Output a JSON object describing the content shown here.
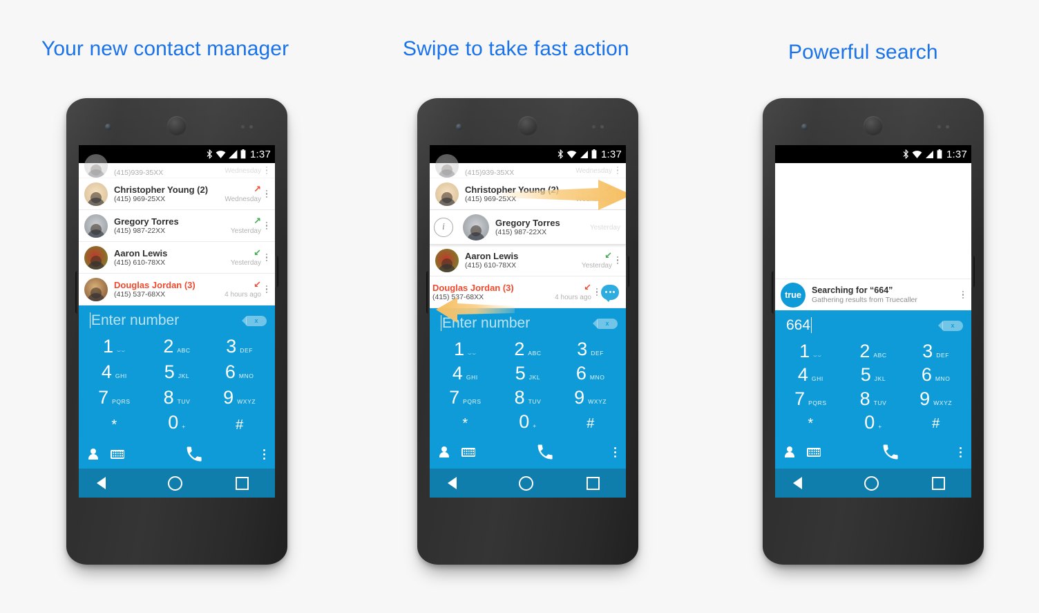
{
  "page": {
    "background_color": "#f7f7f7",
    "accent_blue": "#1a73e8",
    "app_blue": "#0f9bd7",
    "navbar_blue": "#0f7ead",
    "missed_red": "#ef4a2d",
    "answered_green": "#3aab4a",
    "swipe_arrow_color": "#f7c873"
  },
  "panels": [
    {
      "title": "Your new contact manager"
    },
    {
      "title": "Swipe to take fast action"
    },
    {
      "title": "Powerful search"
    }
  ],
  "statusbar": {
    "time": "1:37",
    "icons": [
      "bluetooth-icon",
      "wifi-icon",
      "cellular-signal-icon",
      "battery-icon"
    ]
  },
  "call_log": {
    "rows": [
      {
        "name": "",
        "number": "(415)939-35XX",
        "time": "Wednesday",
        "direction": "",
        "missed": false,
        "partial": true
      },
      {
        "name": "Christopher Young (2)",
        "number": "(415) 969-25XX",
        "time": "Wednesday",
        "direction": "outgoing-missed",
        "arrow": "↗",
        "missed": false
      },
      {
        "name": "Gregory Torres",
        "number": "(415) 987-22XX",
        "time": "Yesterday",
        "direction": "outgoing-answered",
        "arrow": "↗",
        "missed": false
      },
      {
        "name": "Aaron Lewis",
        "number": "(415) 610-78XX",
        "time": "Yesterday",
        "direction": "incoming-answered",
        "arrow": "↙",
        "missed": false
      },
      {
        "name": "Douglas Jordan (3)",
        "number": "(415) 537-68XX",
        "time": "4 hours ago",
        "direction": "incoming-missed",
        "arrow": "↙",
        "missed": true
      }
    ]
  },
  "swipe_panel": {
    "info_icon_label": "i",
    "swipe_right_target": "Gregory Torres",
    "swipe_left_target": "Douglas Jordan (3)",
    "message_action_icon": "message-bubble-icon"
  },
  "search_panel": {
    "logo_text": "true",
    "result_title": "Searching for “664”",
    "result_subtitle": "Gathering results from Truecaller"
  },
  "dialpad": {
    "placeholder": "Enter number",
    "entered_value": "664",
    "backspace_label": "x",
    "keys": [
      {
        "digit": "1",
        "sub": "⌣⌣",
        "sub_name": "voicemail-icon"
      },
      {
        "digit": "2",
        "sub": "ABC"
      },
      {
        "digit": "3",
        "sub": "DEF"
      },
      {
        "digit": "4",
        "sub": "GHI"
      },
      {
        "digit": "5",
        "sub": "JKL"
      },
      {
        "digit": "6",
        "sub": "MNO"
      },
      {
        "digit": "7",
        "sub": "PQRS"
      },
      {
        "digit": "8",
        "sub": "TUV"
      },
      {
        "digit": "9",
        "sub": "WXYZ"
      },
      {
        "digit": "*",
        "sub": ""
      },
      {
        "digit": "0",
        "sub": "+"
      },
      {
        "digit": "#",
        "sub": ""
      }
    ],
    "actions": [
      "contacts-icon",
      "keyboard-icon",
      "call-icon",
      "overflow-menu-icon"
    ]
  },
  "navbar": {
    "buttons": [
      "back-icon",
      "home-icon",
      "recents-icon"
    ]
  }
}
